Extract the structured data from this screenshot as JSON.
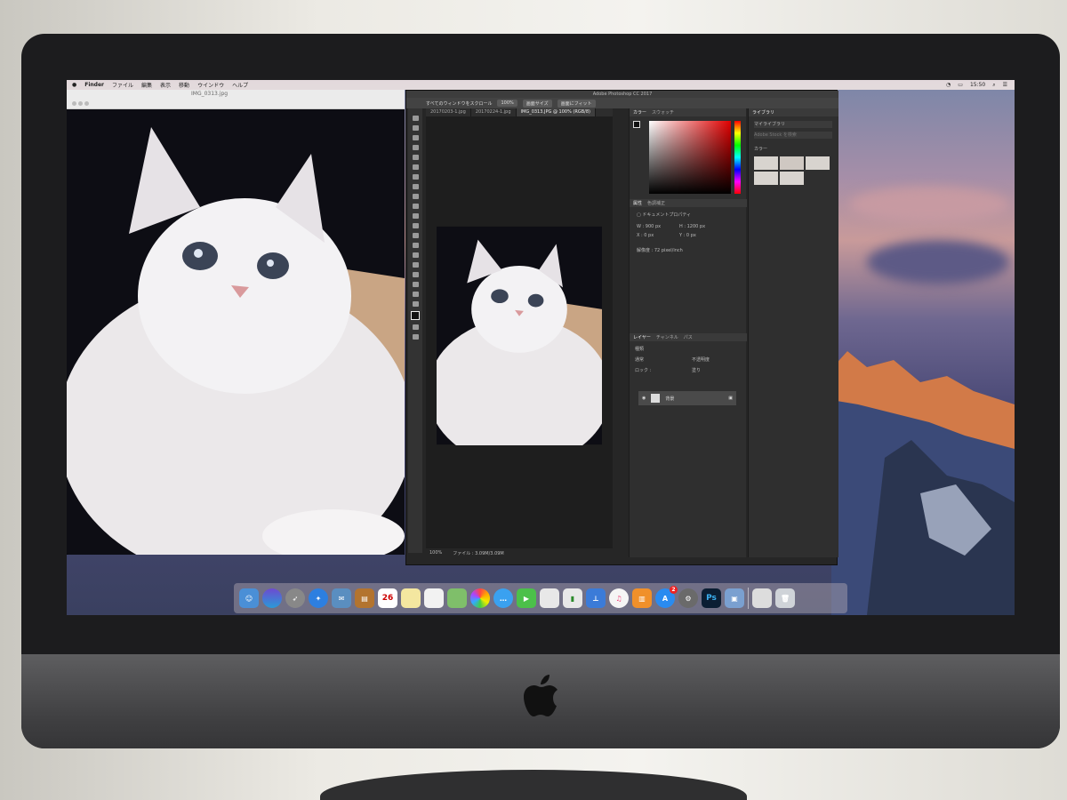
{
  "menubar": {
    "app": "Finder",
    "items": [
      "ファイル",
      "編集",
      "表示",
      "移動",
      "ウインドウ",
      "ヘルプ"
    ],
    "clock": "15:50"
  },
  "preview": {
    "title": "IMG_0313.jpg"
  },
  "photoshop": {
    "window_title": "Adobe Photoshop CC 2017",
    "options": {
      "scroll_all": "すべてのウィンドウをスクロール",
      "zoom": "100%",
      "screen_size": "画面サイズ",
      "fit_screen": "画面にフィット"
    },
    "tabs": [
      "20170203-1.jpg",
      "20170224-1.jpg",
      "IMG_0313.JPG @ 100% (RGB/8)"
    ],
    "status": {
      "zoom": "100%",
      "file": "ファイル : 3.09M/3.09M"
    },
    "color_panel": {
      "tab1": "カラー",
      "tab2": "スウォッチ"
    },
    "properties_panel": {
      "tab1": "属性",
      "tab2": "色調補正",
      "doc": "ドキュメントプロパティ",
      "w": "W : 900 px",
      "h": "H : 1200 px",
      "x": "X : 0 px",
      "y": "Y : 0 px",
      "res": "解像度 : 72 pixel/inch"
    },
    "layers_panel": {
      "tab1": "レイヤー",
      "tab2": "チャンネル",
      "tab3": "パス",
      "kind": "種類",
      "blend": "通常",
      "opacity": "不透明度",
      "lock": "ロック :",
      "fill": "塗り",
      "layer_name": "背景"
    },
    "library_panel": {
      "tab": "ライブラリ",
      "select": "マイライブラリ",
      "search": "Adobe Stock を検索",
      "section": "カラー"
    }
  },
  "dock": {
    "calendar_day": "26",
    "appstore_badge": "2",
    "ps_label": "Ps"
  }
}
